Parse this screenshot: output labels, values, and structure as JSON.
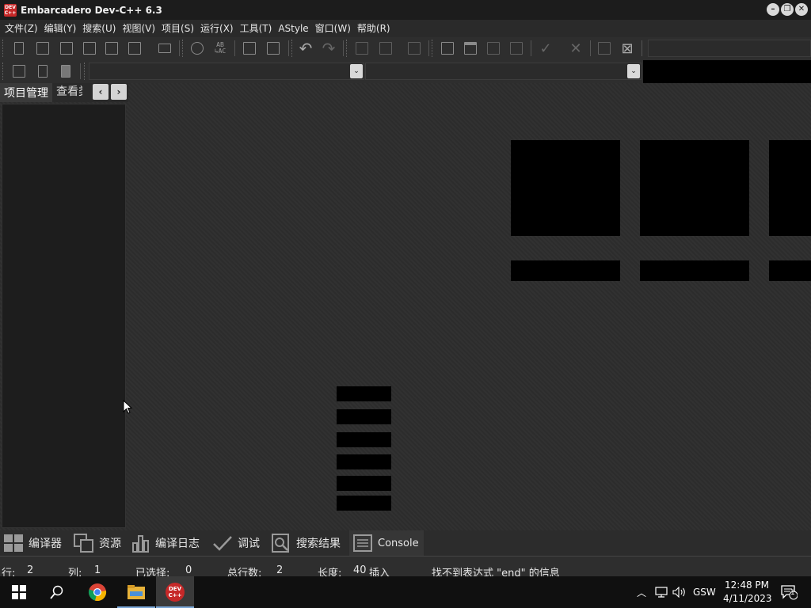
{
  "window": {
    "icon_text": "DEV C++",
    "title": "Embarcadero Dev-C++ 6.3",
    "controls": {
      "minimize": "–",
      "restore": "❐",
      "close": "✕"
    }
  },
  "menu": [
    "文件(Z)",
    "编辑(Y)",
    "搜索(U)",
    "视图(V)",
    "项目(S)",
    "运行(X)",
    "工具(T)",
    "AStyle",
    "窗口(W)",
    "帮助(R)"
  ],
  "toolbar": {
    "replace_icon_text": "AB\n↳AC"
  },
  "left_panel": {
    "tabs": [
      "项目管理",
      "查看类"
    ],
    "scroll_left": "‹",
    "scroll_right": "›"
  },
  "dock_tabs": [
    "编译器",
    "资源",
    "编译日志",
    "调试",
    "搜索结果",
    "Console"
  ],
  "status": {
    "row_label": "行:",
    "row_value": "2",
    "col_label": "列:",
    "col_value": "1",
    "sel_label": "已选择:",
    "sel_value": "0",
    "total_label": "总行数:",
    "total_value": "2",
    "len_label": "长度:",
    "len_value": "40",
    "mode": "插入",
    "message": "找不到表达式 \"end\" 的信息"
  },
  "taskbar": {
    "tray": {
      "ime": "GSW",
      "time": "12:48 PM",
      "date": "4/11/2023",
      "notifications": "1"
    },
    "devcpp_icon_text": "DEV C++"
  },
  "colors": {
    "devcpp_red": "#c62828",
    "accent_blue": "#7aa6d6"
  }
}
